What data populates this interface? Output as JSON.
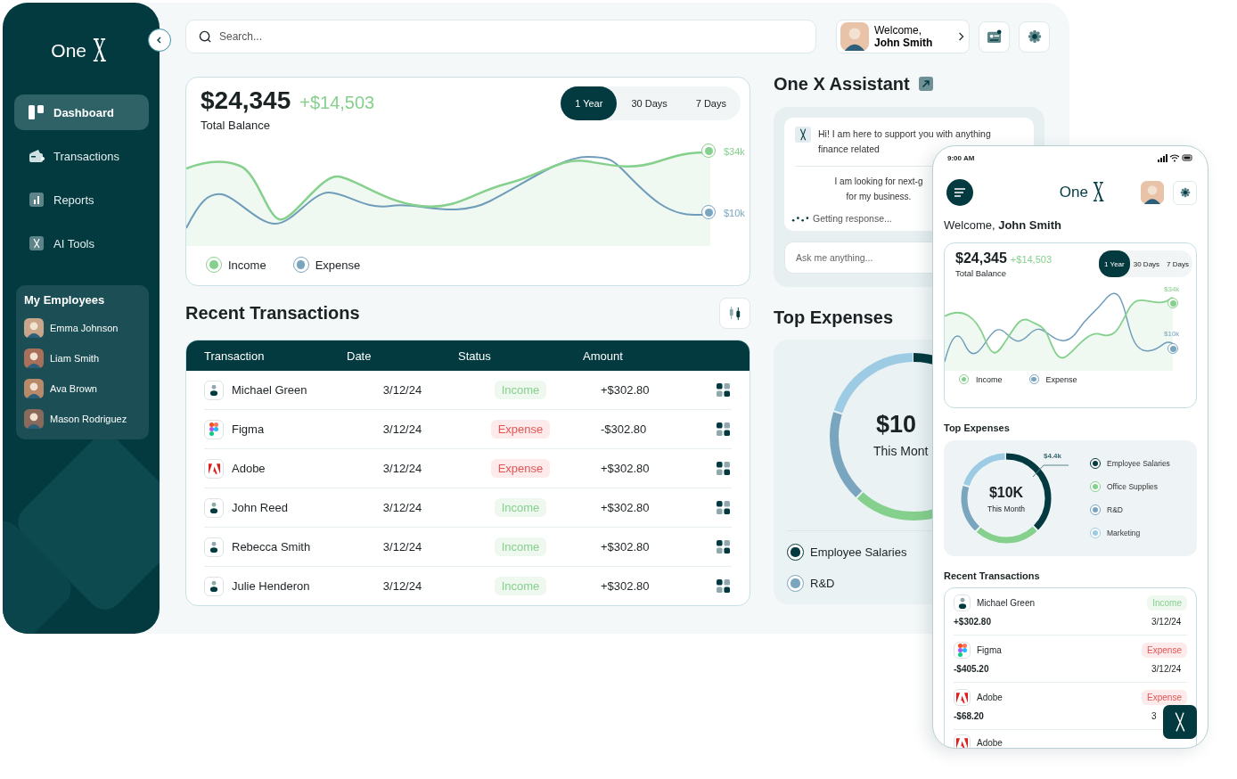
{
  "sidebar": {
    "logo": {
      "text": "One",
      "mark": "X"
    },
    "nav": [
      {
        "label": "Dashboard",
        "kind": "dashboard",
        "selected": true
      },
      {
        "label": "Transactions",
        "kind": "wallet",
        "selected": false
      },
      {
        "label": "Reports",
        "kind": "reports",
        "selected": false
      },
      {
        "label": "AI Tools",
        "kind": "ai",
        "selected": false
      }
    ],
    "employees": {
      "title": "My Employees",
      "items": [
        {
          "name": "Emma Johnson",
          "color": "#c9a58a"
        },
        {
          "name": "Liam Smith",
          "color": "#a8705a"
        },
        {
          "name": "Ava Brown",
          "color": "#b98a6a"
        },
        {
          "name": "Mason Rodriguez",
          "color": "#8a6a5a"
        }
      ]
    }
  },
  "search": {
    "placeholder": "Search..."
  },
  "user": {
    "greeting": "Welcome,",
    "name": "John Smith"
  },
  "balance": {
    "amount": "$24,345",
    "change": "+$14,503",
    "label": "Total Balance",
    "ranges": [
      {
        "label": "1 Year",
        "selected": true
      },
      {
        "label": "30 Days",
        "selected": false
      },
      {
        "label": "7 Days",
        "selected": false
      }
    ],
    "markers": [
      {
        "label": "$34k",
        "kind": "income"
      },
      {
        "label": "$10k",
        "kind": "expense"
      }
    ],
    "legend": [
      {
        "label": "Income",
        "color": "#86d08e"
      },
      {
        "label": "Expense",
        "color": "#7aa5bf"
      }
    ]
  },
  "assistant": {
    "title": "One X Assistant",
    "messages": [
      {
        "kind": "bot",
        "lines": [
          "Hi! I am here to support you with anything",
          "finance related"
        ]
      },
      {
        "kind": "user",
        "lines": [
          "I am looking for next-g",
          "for my business."
        ]
      }
    ],
    "status": "Getting response...",
    "placeholder": "Ask me anything..."
  },
  "transactions": {
    "title": "Recent Transactions",
    "columns": [
      "Transaction",
      "Date",
      "Status",
      "Amount"
    ],
    "rows": [
      {
        "name": "Michael Green",
        "kind": "person",
        "date": "3/12/24",
        "status": {
          "text": "Income",
          "kind": "income"
        },
        "amount": "+$302.80"
      },
      {
        "name": "Figma",
        "kind": "figma",
        "date": "3/12/24",
        "status": {
          "text": "Expense",
          "kind": "expense"
        },
        "amount": "-$302.80"
      },
      {
        "name": "Adobe",
        "kind": "adobe",
        "date": "3/12/24",
        "status": {
          "text": "Expense",
          "kind": "expense"
        },
        "amount": "+$302.80"
      },
      {
        "name": "John Reed",
        "kind": "person",
        "date": "3/12/24",
        "status": {
          "text": "Income",
          "kind": "income"
        },
        "amount": "+$302.80"
      },
      {
        "name": "Rebecca Smith",
        "kind": "person",
        "date": "3/12/24",
        "status": {
          "text": "Income",
          "kind": "income"
        },
        "amount": "+$302.80"
      },
      {
        "name": "Julie Henderon",
        "kind": "person",
        "date": "3/12/24",
        "status": {
          "text": "Income",
          "kind": "income"
        },
        "amount": "+$302.80"
      }
    ]
  },
  "top_expenses": {
    "title": "Top Expenses",
    "total": "$10",
    "caption": "This Mont",
    "legend": [
      {
        "label": "Employee Salaries",
        "color": "#033a40"
      },
      {
        "label": "R&D",
        "color": "#7aa5bf"
      }
    ]
  },
  "phone": {
    "time": "9:00 AM",
    "logo": {
      "text": "One",
      "mark": "X"
    },
    "greeting": "Welcome,",
    "name": "John Smith",
    "balance": {
      "amount": "$24,345",
      "change": "+$14,503",
      "label": "Total Balance",
      "ranges": [
        {
          "label": "1 Year",
          "selected": true
        },
        {
          "label": "30 Days",
          "selected": false
        },
        {
          "label": "7 Days",
          "selected": false
        }
      ],
      "markers": [
        {
          "label": "$34k",
          "kind": "income"
        },
        {
          "label": "$10k",
          "kind": "expense"
        }
      ],
      "legend": [
        {
          "label": "Income",
          "color": "#86d08e"
        },
        {
          "label": "Expense",
          "color": "#7aa5bf"
        }
      ]
    },
    "top_expenses": {
      "title": "Top Expenses",
      "callout": "$4.4k",
      "total": "$10K",
      "caption": "This Month",
      "legend": [
        {
          "label": "Employee Salaries",
          "color": "#033a40"
        },
        {
          "label": "Office Supplies",
          "color": "#86d08e"
        },
        {
          "label": "R&D",
          "color": "#7aa5bf"
        },
        {
          "label": "Marketing",
          "color": "#9ccbe3"
        }
      ]
    },
    "transactions": {
      "title": "Recent Transactions",
      "rows": [
        {
          "name": "Michael Green",
          "kind": "person",
          "status": {
            "text": "Income",
            "kind": "income"
          },
          "amount": "+$302.80",
          "date": "3/12/24"
        },
        {
          "name": "Figma",
          "kind": "figma",
          "status": {
            "text": "Expense",
            "kind": "expense"
          },
          "amount": "-$405.20",
          "date": "3/12/24"
        },
        {
          "name": "Adobe",
          "kind": "adobe",
          "status": {
            "text": "Expense",
            "kind": "expense"
          },
          "amount": "-$68.20",
          "date": "3"
        },
        {
          "name": "Adobe",
          "kind": "adobe"
        }
      ]
    }
  }
}
